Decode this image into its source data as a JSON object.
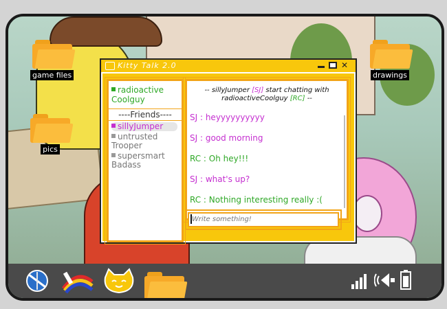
{
  "desktop": {
    "icons": [
      {
        "label": "game files"
      },
      {
        "label": "pics"
      },
      {
        "label": "drawings"
      }
    ]
  },
  "window": {
    "title": "Kitty Talk 2.0"
  },
  "sidebar": {
    "current_user": "radioactive Coolguy",
    "friends_header": "----Friends----",
    "friends": [
      {
        "name": "sillyJumper",
        "status": "online"
      },
      {
        "name": "untrusted Trooper",
        "status": "offline"
      },
      {
        "name": "supersmart Badass",
        "status": "offline"
      }
    ]
  },
  "chat": {
    "system_prefix": "-- sillyJumper",
    "system_tag1": "[SJ]",
    "system_mid": "start chatting with radioactiveCoolguy",
    "system_tag2": "[RC]",
    "system_suffix": "--",
    "messages": [
      {
        "text": "SJ : heyyyyyyyyyy",
        "who": "SJ"
      },
      {
        "text": "SJ : good morning",
        "who": "SJ"
      },
      {
        "text": "RC : Oh hey!!!",
        "who": "RC"
      },
      {
        "text": "SJ : what's up?",
        "who": "SJ"
      },
      {
        "text": "RC : Nothing interesting really :(",
        "who": "RC"
      }
    ],
    "input_placeholder": "Write something!"
  },
  "taskbar": {
    "items": [
      "browser-icon",
      "paint-icon",
      "kitty-talk-icon",
      "folder-icon"
    ],
    "tray": [
      "signal-icon",
      "volume-icon",
      "battery-icon"
    ]
  },
  "colors": {
    "accent": "#f8c70c",
    "sj": "#c52fd0",
    "rc": "#2fa827",
    "folder": "#f7a928"
  }
}
